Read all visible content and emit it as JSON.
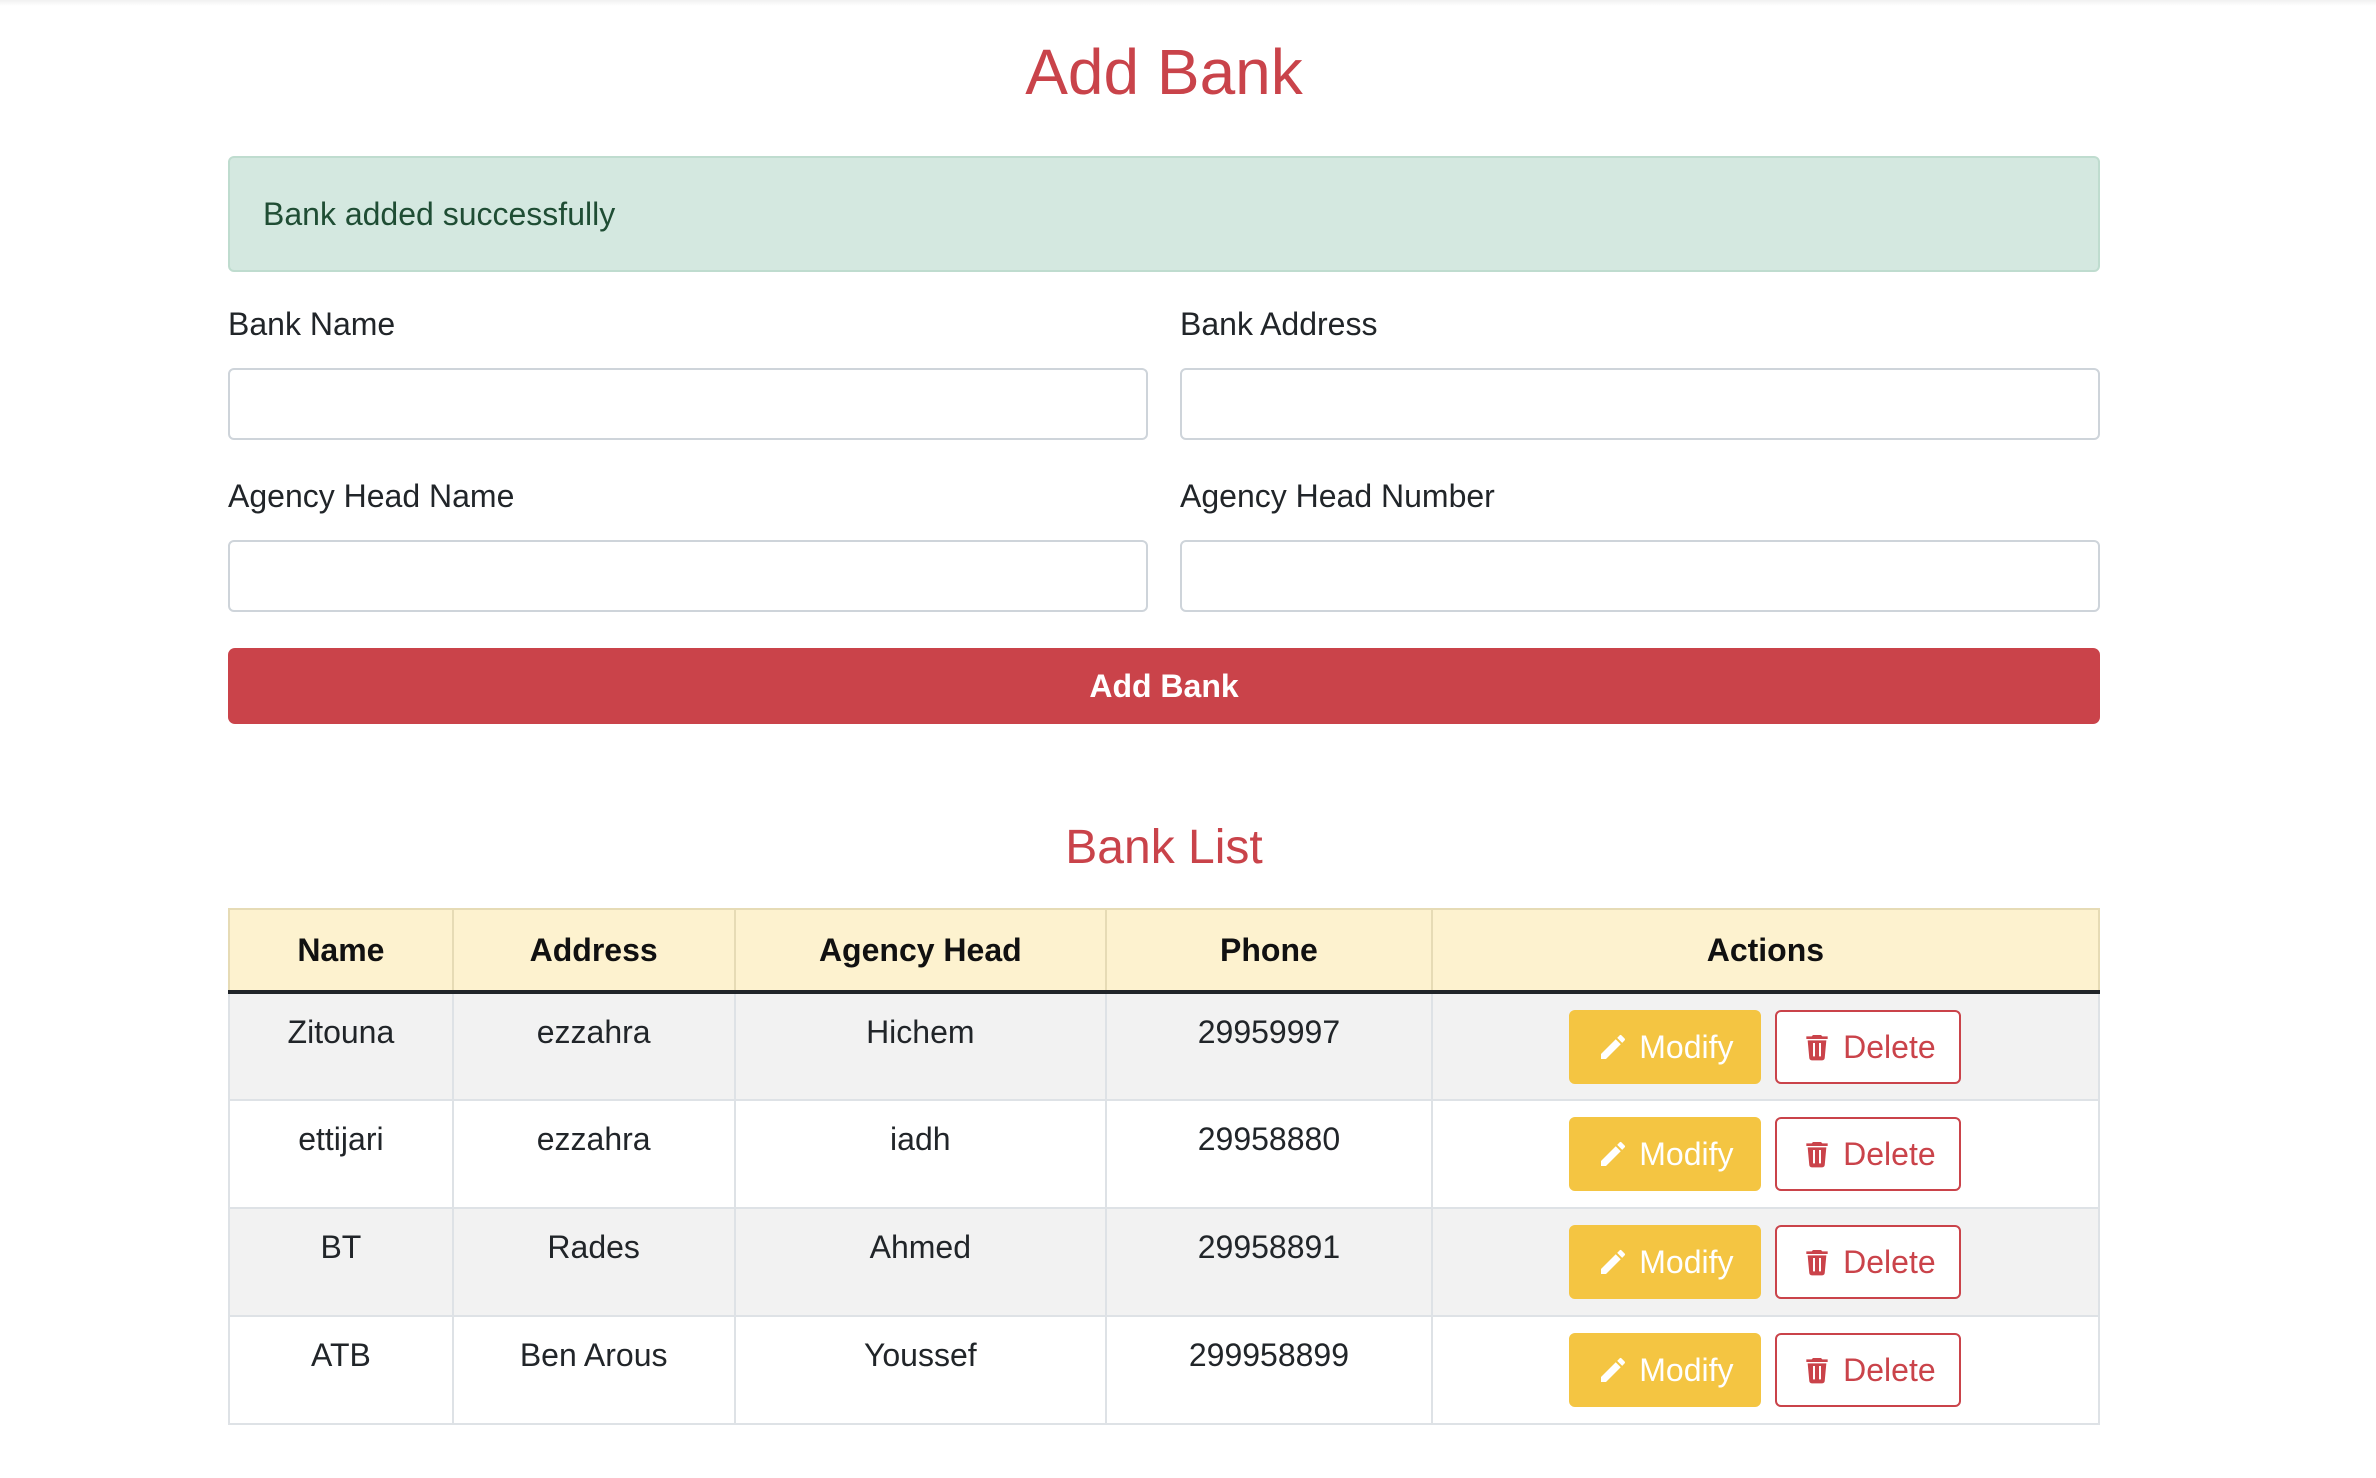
{
  "page": {
    "title": "Add Bank"
  },
  "alert": {
    "message": "Bank added successfully"
  },
  "form": {
    "bank_name": {
      "label": "Bank Name",
      "value": ""
    },
    "bank_address": {
      "label": "Bank Address",
      "value": ""
    },
    "agency_head_name": {
      "label": "Agency Head Name",
      "value": ""
    },
    "agency_head_number": {
      "label": "Agency Head Number",
      "value": ""
    },
    "submit_label": "Add Bank"
  },
  "bank_list": {
    "title": "Bank List",
    "columns": [
      "Name",
      "Address",
      "Agency Head",
      "Phone",
      "Actions"
    ],
    "rows": [
      {
        "name": "Zitouna",
        "address": "ezzahra",
        "agency_head": "Hichem",
        "phone": "29959997",
        "modify_label": "Modify",
        "delete_label": "Delete"
      },
      {
        "name": "ettijari",
        "address": "ezzahra",
        "agency_head": "iadh",
        "phone": "29958880",
        "modify_label": "Modify",
        "delete_label": "Delete"
      },
      {
        "name": "BT",
        "address": "Rades",
        "agency_head": "Ahmed",
        "phone": "29958891",
        "modify_label": "Modify",
        "delete_label": "Delete"
      },
      {
        "name": "ATB",
        "address": "Ben Arous",
        "agency_head": "Youssef",
        "phone": "299958899",
        "modify_label": "Modify",
        "delete_label": "Delete"
      }
    ]
  },
  "icons": {
    "modify": "pencil-icon",
    "delete": "trash-icon"
  },
  "colors": {
    "accent": "#ca434a",
    "alert_bg": "#d4e8e0",
    "alert_text": "#1f4d34",
    "table_header_bg": "#fdf2cf",
    "modify_bg": "#f4c542"
  }
}
